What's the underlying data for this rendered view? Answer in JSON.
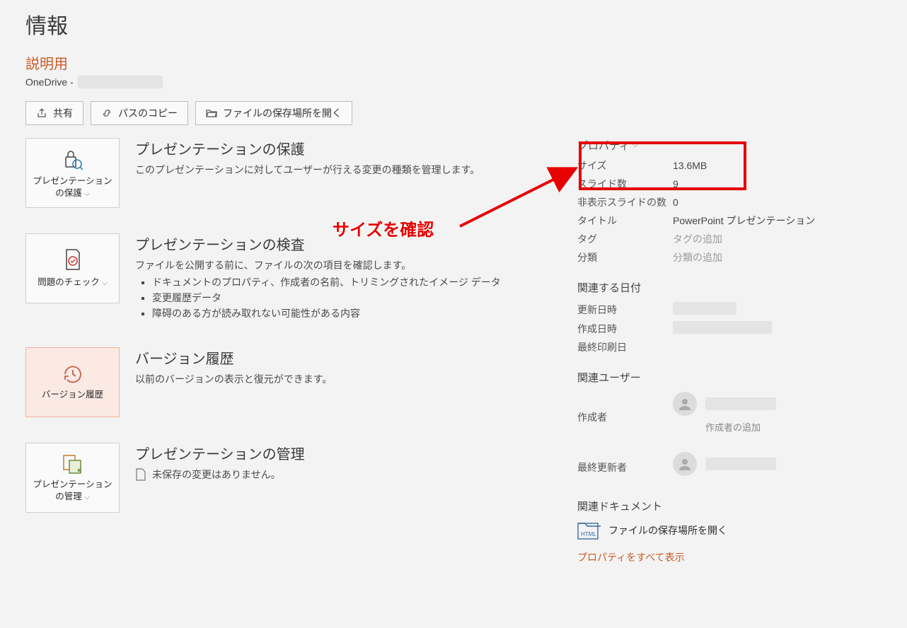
{
  "header": {
    "title": "情報",
    "doc_title": "説明用",
    "path_prefix": "OneDrive -"
  },
  "actions": {
    "share": "共有",
    "copy_path": "パスのコピー",
    "open_location": "ファイルの保存場所を開く"
  },
  "sections": {
    "protect": {
      "btn": "プレゼンテーションの保護",
      "title": "プレゼンテーションの保護",
      "desc": "このプレゼンテーションに対してユーザーが行える変更の種類を管理します。"
    },
    "inspect": {
      "btn": "問題のチェック",
      "title": "プレゼンテーションの検査",
      "desc": "ファイルを公開する前に、ファイルの次の項目を確認します。",
      "items": [
        "ドキュメントのプロパティ、作成者の名前、トリミングされたイメージ データ",
        "変更履歴データ",
        "障碍のある方が読み取れない可能性がある内容"
      ]
    },
    "version": {
      "btn": "バージョン履歴",
      "title": "バージョン履歴",
      "desc": "以前のバージョンの表示と復元ができます。"
    },
    "manage": {
      "btn": "プレゼンテーションの管理",
      "title": "プレゼンテーションの管理",
      "desc": "未保存の変更はありません。"
    }
  },
  "properties": {
    "heading": "プロパティ",
    "size_label": "サイズ",
    "size_value": "13.6MB",
    "slides_label": "スライド数",
    "slides_value": "9",
    "hidden_label": "非表示スライドの数",
    "hidden_value": "0",
    "title_label": "タイトル",
    "title_value": "PowerPoint プレゼンテーション",
    "tag_label": "タグ",
    "tag_placeholder": "タグの追加",
    "category_label": "分類",
    "category_placeholder": "分類の追加"
  },
  "dates": {
    "heading": "関連する日付",
    "modified_label": "更新日時",
    "created_label": "作成日時",
    "printed_label": "最終印刷日"
  },
  "users": {
    "heading": "関連ユーザー",
    "author_label": "作成者",
    "add_author": "作成者の追加",
    "last_modified_label": "最終更新者"
  },
  "docs": {
    "heading": "関連ドキュメント",
    "open_location": "ファイルの保存場所を開く",
    "show_all": "プロパティをすべて表示"
  },
  "annotation": {
    "text": "サイズを確認"
  }
}
